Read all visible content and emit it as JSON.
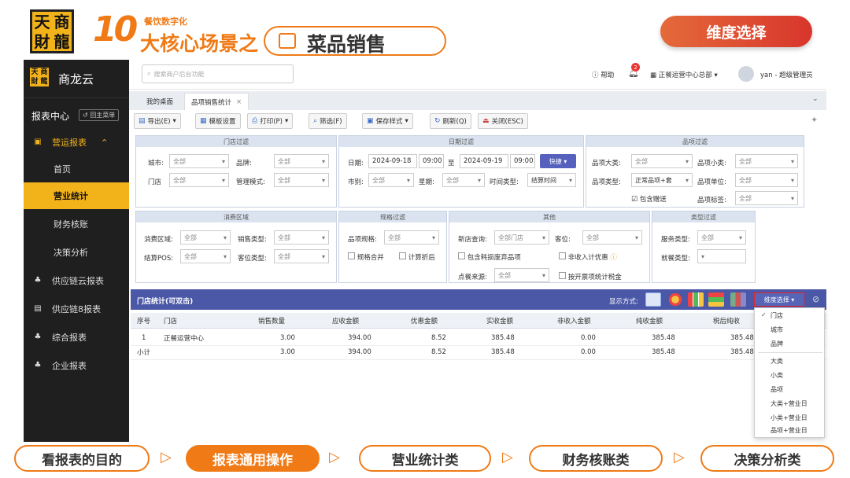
{
  "banner": {
    "logo_chars": [
      "天",
      "商",
      "財",
      "龍"
    ],
    "number": "10",
    "subtitle": "餐饮数字化",
    "headline": "大核心场景之",
    "pill_text": "菜品销售",
    "dim_button": "维度选择"
  },
  "sidebar": {
    "brand": "商龙云",
    "report_center": "报表中心",
    "back_label": "回主菜单",
    "items": [
      {
        "label": "营运报表",
        "icon": "▣"
      },
      {
        "label": "首页"
      },
      {
        "label": "营业统计"
      },
      {
        "label": "财务核账"
      },
      {
        "label": "决策分析"
      },
      {
        "label": "供应链云报表",
        "icon": "♣"
      },
      {
        "label": "供应链8报表",
        "icon": "▤"
      },
      {
        "label": "综合报表",
        "icon": "♣"
      },
      {
        "label": "企业报表",
        "icon": "♣"
      }
    ]
  },
  "topbar": {
    "search_placeholder": "搜索商户后台功能",
    "help": "帮助",
    "notif_count": "2",
    "org": "正餐运营中心总部",
    "user": "yan - 超级管理员"
  },
  "tabs": [
    {
      "label": "我的桌面"
    },
    {
      "label": "品项销售统计"
    }
  ],
  "toolbar": [
    "导出(E)",
    "模板设置",
    "打印(P)",
    "筛选(F)",
    "保存样式",
    "刷新(Q)",
    "关闭(ESC)"
  ],
  "filters": {
    "store": {
      "title": "门店过滤",
      "city": "城市:",
      "brand": "品牌:",
      "store": "门店",
      "mgmt": "管理模式:",
      "all": "全部"
    },
    "date": {
      "title": "日期过滤",
      "date_lbl": "日期:",
      "from": "2024-09-18",
      "from_t": "09:00",
      "to_lbl": "至",
      "to": "2024-09-19",
      "to_t": "09:00",
      "quick": "快捷",
      "market": "市别:",
      "week": "星期:",
      "timetype": "时间类型:",
      "timetype_val": "结算时间"
    },
    "item": {
      "title": "品项过滤",
      "big": "品项大类:",
      "small": "品项小类:",
      "type": "品项类型:",
      "type_val": "正常品项+套",
      "unit": "品项单位:",
      "gift": "包含赠送",
      "tag": "品项标签:"
    },
    "consume": {
      "title": "消费区域",
      "area": "消费区域:",
      "saletype": "销售类型:",
      "pos": "结算POS:",
      "seat": "客位类型:"
    },
    "spec": {
      "title": "规格过滤",
      "spec": "品项规格:",
      "merge": "规格合并",
      "discount": "计算折后"
    },
    "other": {
      "title": "其他",
      "newstore": "新店查询:",
      "newstore_val": "全部门店",
      "seatlbl": "客位:",
      "lossitem": "包含耗损废弃品项",
      "noincome": "非收入计优惠",
      "source": "点餐来源:",
      "tax": "按开票项统计税金"
    },
    "classtype": {
      "title": "类型过滤",
      "service": "服务类型:",
      "dining": "就餐类型:"
    }
  },
  "stats": {
    "title": "门店统计(可双击)",
    "view_label": "显示方式:",
    "dim_select": "维度选择",
    "columns": [
      "序号",
      "门店",
      "销售数量",
      "应收金额",
      "优惠金额",
      "实收金额",
      "非收入金额",
      "纯收金额",
      "税后纯收"
    ],
    "rows": [
      [
        "1",
        "正餐运营中心",
        "3.00",
        "394.00",
        "8.52",
        "385.48",
        "0.00",
        "385.48",
        "385.48"
      ],
      [
        "小计",
        "",
        "3.00",
        "394.00",
        "8.52",
        "385.48",
        "0.00",
        "385.48",
        "385.48"
      ]
    ]
  },
  "dropdown": [
    "门店",
    "城市",
    "品牌",
    "大类",
    "小类",
    "品项",
    "大类+营业日",
    "小类+营业日",
    "品项+营业日"
  ],
  "bottom_nav": [
    "看报表的目的",
    "报表通用操作",
    "营业统计类",
    "财务核账类",
    "决策分析类"
  ]
}
